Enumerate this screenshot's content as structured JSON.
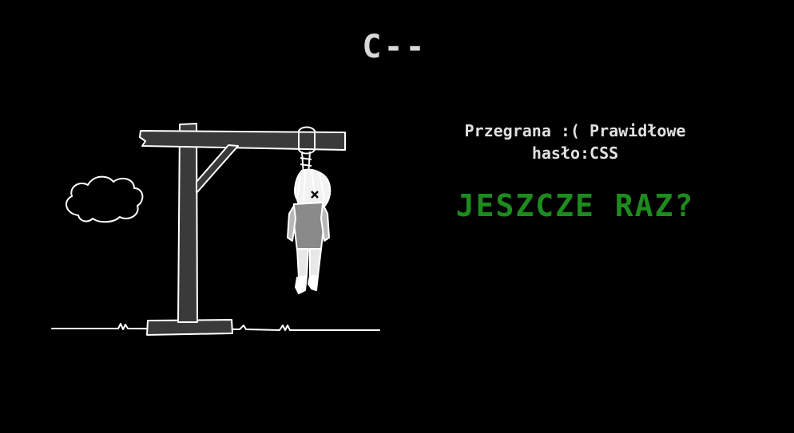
{
  "game": {
    "masked_word": "C--",
    "result_line_1": "Przegrana :( Prawidłowe",
    "result_line_2": "hasło:CSS",
    "retry_label": "JESZCZE RAZ?"
  },
  "colors": {
    "background": "#000000",
    "word": "#d8d8d8",
    "message": "#e0e0e0",
    "retry": "#1d8b1d",
    "drawing_stroke": "#ffffff",
    "wood_fill": "#3a3a3a"
  },
  "icons": {
    "scene": "hangman-gallows-drawing",
    "cloud": "cloud-icon"
  }
}
